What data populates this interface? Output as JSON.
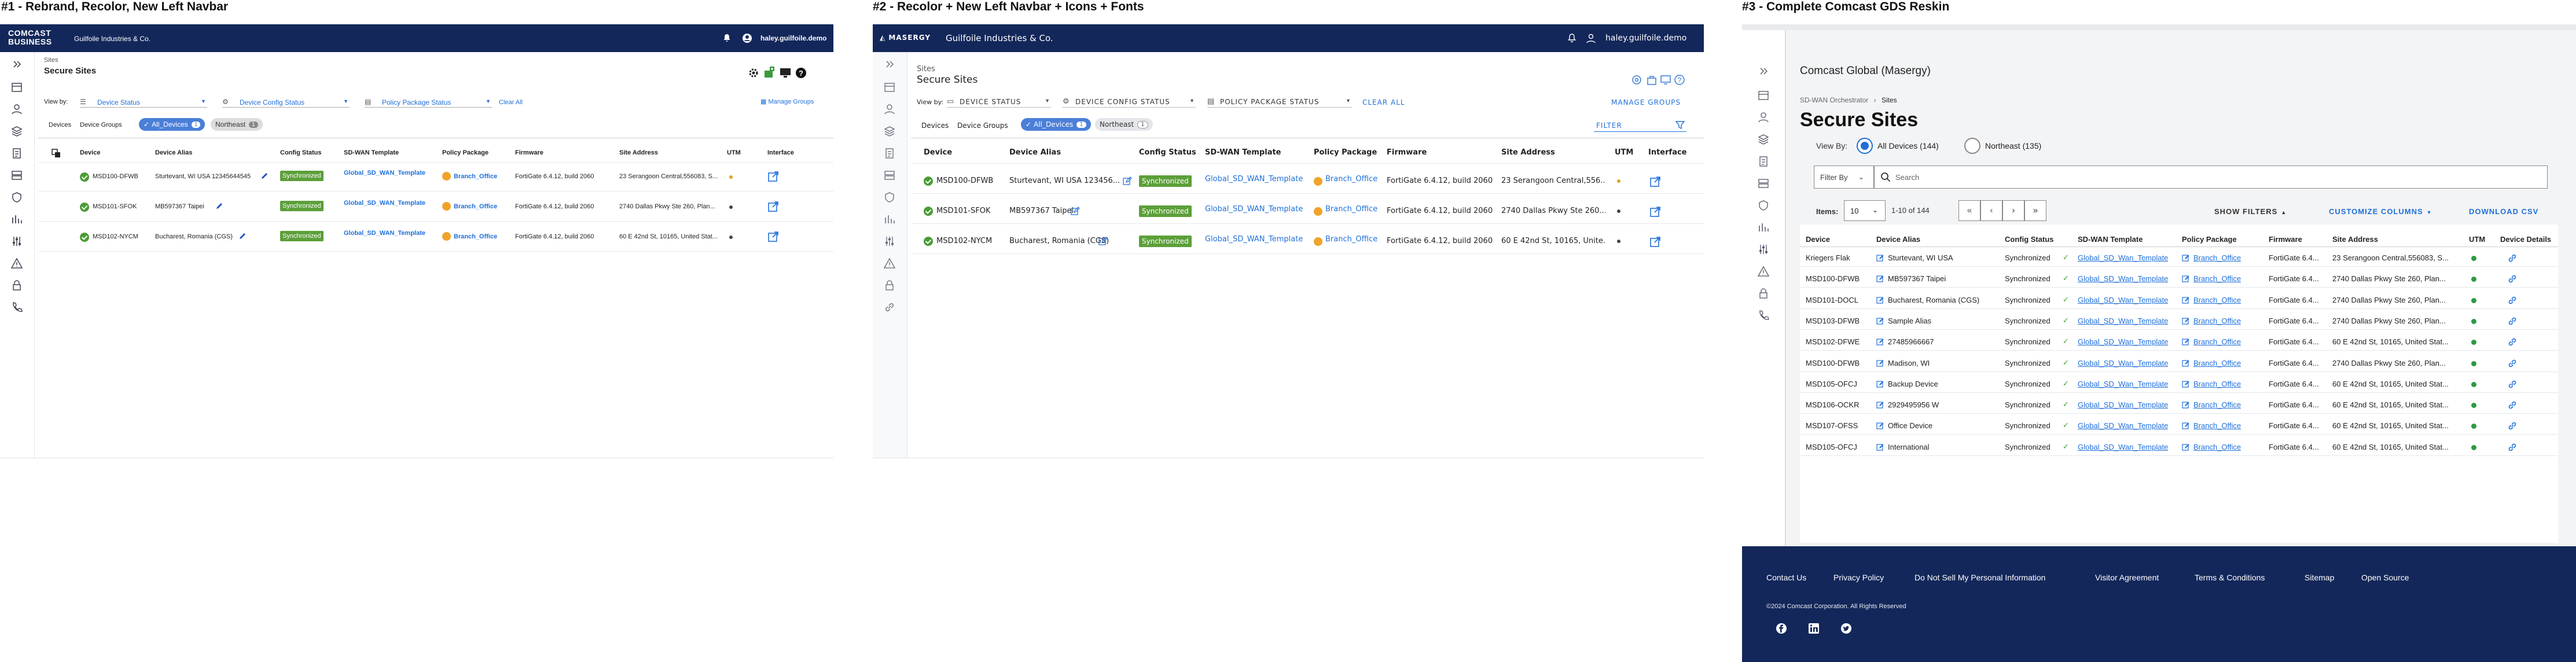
{
  "titles": {
    "p1": "#1 - Rebrand, Recolor,  New Left Navbar",
    "p2": "#2 - Recolor + New Left Navbar + Icons + Fonts",
    "p3": "#3 - Complete Comcast GDS Reskin"
  },
  "p1": {
    "brand_line1": "COMCAST",
    "brand_line2": "BUSINESS",
    "company": "Guilfoile Industries & Co.",
    "user": "haley.guilfoile.demo",
    "breadcrumb": "Sites",
    "page_title": "Secure Sites",
    "view_by": "View by:",
    "filters": [
      "Device Status",
      "Device Config Status",
      "Policy Package Status"
    ],
    "clear_all": "Clear All",
    "manage_groups": "Manage Groups",
    "tabs": [
      "Devices",
      "Device Groups"
    ],
    "chips": [
      "All_Devices",
      "Northeast"
    ],
    "chip_counts": [
      "1",
      "1"
    ],
    "columns": [
      "Device",
      "Device Alias",
      "Config Status",
      "SD-WAN Template",
      "Policy Package",
      "Firmware",
      "Site Address",
      "UTM",
      "Interface"
    ],
    "rows": [
      {
        "device": "MSD100-DFWB",
        "alias": "Sturtevant, WI USA  12345644545",
        "status": "Synchronized",
        "template": "Global_SD_WAN_Template",
        "policy": "Branch_Office",
        "firmware": "FortiGate 6.4.12, build 2060",
        "address": "23 Serangoon Central,556083, S..."
      },
      {
        "device": "MSD101-SFOK",
        "alias": "MB597367 Taipei",
        "status": "Synchronized",
        "template": "Global_SD_WAN_Template",
        "policy": "Branch_Office",
        "firmware": "FortiGate 6.4.12, build 2060",
        "address": "2740 Dallas Pkwy Ste 260, Plan..."
      },
      {
        "device": "MSD102-NYCM",
        "alias": "Bucharest, Romania (CGS)",
        "status": "Synchronized",
        "template": "Global_SD_WAN_Template",
        "policy": "Branch_Office",
        "firmware": "FortiGate 6.4.12, build 2060",
        "address": "60 E 42nd St, 10165, United Stat..."
      }
    ]
  },
  "p2": {
    "brand": "MASERGY",
    "company": "Guilfoile Industries & Co.",
    "user": "haley.guilfoile.demo",
    "breadcrumb": "Sites",
    "page_title": "Secure Sites",
    "view_by": "View by:",
    "filters": [
      "DEVICE STATUS",
      "DEVICE CONFIG STATUS",
      "POLICY PACKAGE STATUS"
    ],
    "clear_all": "CLEAR ALL",
    "manage_groups": "MANAGE GROUPS",
    "tabs": [
      "Devices",
      "Device Groups"
    ],
    "chips": [
      "All_Devices",
      "Northeast"
    ],
    "chip_counts": [
      "1",
      "1"
    ],
    "filter_placeholder": "FILTER",
    "columns": [
      "Device",
      "Device Alias",
      "Config Status",
      "SD-WAN Template",
      "Policy Package",
      "Firmware",
      "Site Address",
      "UTM",
      "Interface"
    ],
    "rows": [
      {
        "device": "MSD100-DFWB",
        "alias": "Sturtevant, WI USA  123456...",
        "status": "Synchronized",
        "template": "Global_SD_WAN_Template",
        "policy": "Branch_Office",
        "firmware": "FortiGate 6.4.12, build 2060",
        "address": "23 Serangoon Central,556..."
      },
      {
        "device": "MSD101-SFOK",
        "alias": "MB597367 Taipei",
        "status": "Synchronized",
        "template": "Global_SD_WAN_Template",
        "policy": "Branch_Office",
        "firmware": "FortiGate 6.4.12, build 2060",
        "address": "2740 Dallas Pkwy Ste 260..."
      },
      {
        "device": "MSD102-NYCM",
        "alias": "Bucharest, Romania (CGS)",
        "status": "Synchronized",
        "template": "Global_SD_WAN_Template",
        "policy": "Branch_Office",
        "firmware": "FortiGate 6.4.12, build 2060",
        "address": "60 E 42nd St, 10165, Unite..."
      }
    ]
  },
  "p3": {
    "org": "Comcast Global (Masergy)",
    "crumb1": "SD-WAN Orchestrator",
    "crumb2": "Sites",
    "page_title": "Secure Sites",
    "view_by": "View By:",
    "radio1": "All Devices (144)",
    "radio2": "Northeast (135)",
    "filter_by": "Filter By",
    "search_placeholder": "Search",
    "items_label": "Items:",
    "items_value": "10",
    "range": "1-10 of 144",
    "show_filters": "SHOW FILTERS",
    "customize_columns": "CUSTOMIZE COLUMNS",
    "download_csv": "DOWNLOAD CSV",
    "columns": [
      "Device",
      "Device Alias",
      "Config Status",
      "SD-WAN Template",
      "Policy Package",
      "Firmware",
      "Site Address",
      "UTM",
      "Device Details"
    ],
    "rows": [
      {
        "device": "Kriegers Flak",
        "alias": "Sturtevant, WI USA",
        "status": "Synchronized",
        "template": "Global_SD_Wan_Template",
        "policy": "Branch_Office",
        "firmware": "FortiGate 6.4...",
        "address": "23 Serangoon Central,556083, S..."
      },
      {
        "device": "MSD100-DFWB",
        "alias": "MB597367 Taipei",
        "status": "Synchronized",
        "template": "Global_SD_Wan_Template",
        "policy": "Branch_Office",
        "firmware": "FortiGate 6.4...",
        "address": "2740 Dallas Pkwy Ste 260, Plan..."
      },
      {
        "device": "MSD101-DOCL",
        "alias": "Bucharest, Romania (CGS)",
        "status": "Synchronized",
        "template": "Global_SD_Wan_Template",
        "policy": "Branch_Office",
        "firmware": "FortiGate 6.4...",
        "address": "2740 Dallas Pkwy Ste 260, Plan..."
      },
      {
        "device": "MSD103-DFWB",
        "alias": "Sample Alias",
        "status": "Synchronized",
        "template": "Global_SD_Wan_Template",
        "policy": "Branch_Office",
        "firmware": "FortiGate 6.4...",
        "address": "2740 Dallas Pkwy Ste 260, Plan..."
      },
      {
        "device": "MSD102-DFWE",
        "alias": "27485966667",
        "status": "Synchronized",
        "template": "Global_SD_Wan_Template",
        "policy": "Branch_Office",
        "firmware": "FortiGate 6.4...",
        "address": "60 E 42nd St, 10165, United Stat..."
      },
      {
        "device": "MSD100-DFWB",
        "alias": "Madison, WI",
        "status": "Synchronized",
        "template": "Global_SD_Wan_Template",
        "policy": "Branch_Office",
        "firmware": "FortiGate 6.4...",
        "address": "2740 Dallas Pkwy Ste 260, Plan..."
      },
      {
        "device": "MSD105-OFCJ",
        "alias": "Backup Device",
        "status": "Synchronized",
        "template": "Global_SD_Wan_Template",
        "policy": "Branch_Office",
        "firmware": "FortiGate 6.4...",
        "address": "60 E 42nd St, 10165, United Stat..."
      },
      {
        "device": "MSD106-OCKR",
        "alias": "2929495956 W",
        "status": "Synchronized",
        "template": "Global_SD_Wan_Template",
        "policy": "Branch_Office",
        "firmware": "FortiGate 6.4...",
        "address": "60 E 42nd St, 10165, United Stat..."
      },
      {
        "device": "MSD107-OFSS",
        "alias": "Office Device",
        "status": "Synchronized",
        "template": "Global_SD_Wan_Template",
        "policy": "Branch_Office",
        "firmware": "FortiGate 6.4...",
        "address": "60 E 42nd St, 10165, United Stat..."
      },
      {
        "device": "MSD105-OFCJ",
        "alias": "International",
        "status": "Synchronized",
        "template": "Global_SD_Wan_Template",
        "policy": "Branch_Office",
        "firmware": "FortiGate 6.4...",
        "address": "60 E 42nd St, 10165, United Stat..."
      }
    ],
    "footer_links": [
      "Contact Us",
      "Privacy Policy",
      "Do Not Sell My Personal Information",
      "Visitor Agreement",
      "Terms & Conditions",
      "Sitemap",
      "Open Source"
    ],
    "copyright": "©2024 Comcast Corporation. All Rights Reserved",
    "social": [
      "facebook-icon",
      "linkedin-icon",
      "twitter-icon"
    ]
  },
  "colors": {
    "navy": "#13275a",
    "link": "#1f6fd9",
    "green": "#5c9f3a",
    "orange": "#f0a32a",
    "footer": "#13275a"
  }
}
